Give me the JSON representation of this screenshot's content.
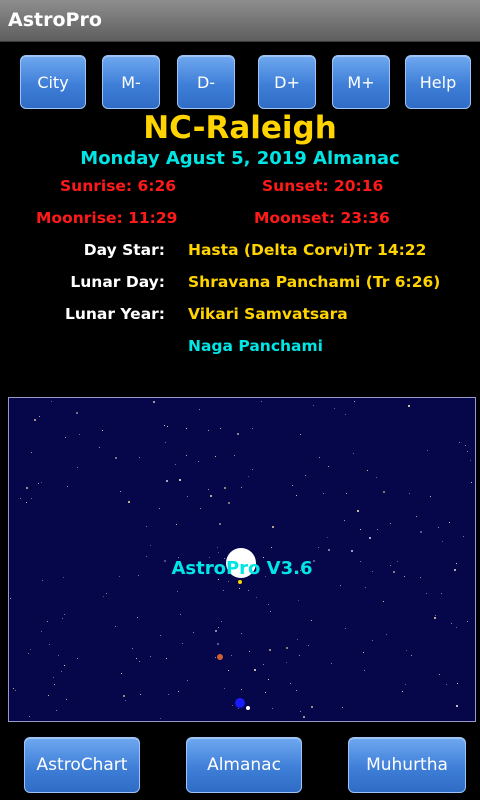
{
  "app": {
    "title": "AstroPro"
  },
  "toolbar": {
    "city": "City",
    "month_prev": "M-",
    "day_prev": "D-",
    "day_next": "D+",
    "month_next": "M+",
    "help": "Help"
  },
  "almanac": {
    "city": "NC-Raleigh",
    "date_line": "Monday Agust 5, 2019 Almanac",
    "sunrise": "Sunrise: 6:26",
    "sunset": "Sunset: 20:16",
    "moonrise": "Moonrise: 11:29",
    "moonset": "Moonset: 23:36",
    "rows": [
      {
        "label": "Day Star:",
        "value": "Hasta (Delta Corvi)Tr 14:22"
      },
      {
        "label": "Lunar Day:",
        "value": "Shravana Panchami (Tr 6:26)"
      },
      {
        "label": "Lunar Year:",
        "value": "Vikari Samvatsara"
      }
    ],
    "festival": "Naga Panchami"
  },
  "sky": {
    "overlay_text": "AstroPro V3.6",
    "colors": {
      "background": "#06064a",
      "moon": "#ffffff",
      "planet_red": "#d06030",
      "planet_blue": "#1a1aff"
    }
  },
  "bottom": {
    "astrochart": "AstroChart",
    "almanac": "Almanac",
    "muhurtha": "Muhurtha"
  }
}
